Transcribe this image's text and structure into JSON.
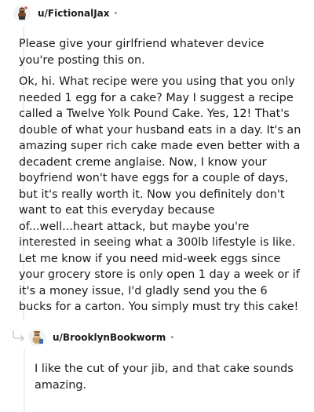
{
  "comments": [
    {
      "username": "u/FictionalJax",
      "paragraphs": [
        "Please give your girlfriend whatever device you're posting this on.",
        "Ok, hi. What recipe were you using that you only needed 1 egg for a cake? May I suggest a recipe called a Twelve Yolk Pound Cake. Yes, 12! That's double of what your husband eats in a day. It's an amazing super rich cake made even better with a decadent creme anglaise. Now, I know your boyfriend won't have eggs for a couple of days, but it's really worth it. Now you definitely don't want to eat this everyday because of...well...heart attack, but maybe you're interested in seeing what a 300lb lifestyle is like. Let me know if you need mid-week eggs since your grocery store is only open 1 day a week or if it's a money issue, I'd gladly send you the 6 bucks for a carton. You simply must try this cake!"
      ]
    },
    {
      "username": "u/BrooklynBookworm",
      "paragraphs": [
        "I like the cut of your jib, and that cake sounds amazing."
      ]
    }
  ],
  "separator": "•",
  "icons": {
    "avatar_1": "snoo-avatar-icon",
    "avatar_2": "snoo-avatar-icon",
    "reply": "reply-arrow-icon"
  },
  "colors": {
    "text": "#1a1a1b",
    "meta": "#878a8c",
    "thread_line": "#edeff1"
  }
}
